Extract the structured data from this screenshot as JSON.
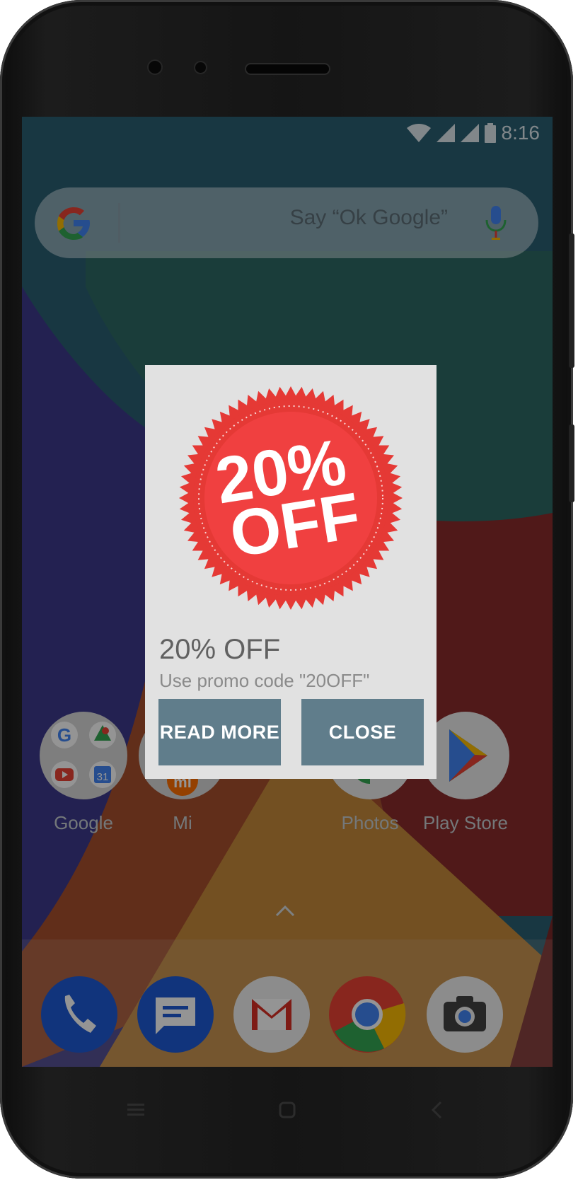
{
  "status_bar": {
    "time": "8:16",
    "icons": [
      "wifi-icon",
      "signal-icon",
      "signal-icon",
      "battery-icon"
    ]
  },
  "search": {
    "placeholder": "Say “Ok Google”",
    "logo": "google-g-icon",
    "voice_icon": "mic-icon"
  },
  "apps": [
    {
      "label": "Google",
      "icon": "google-folder-icon"
    },
    {
      "label": "Mi",
      "icon": "mi-folder-icon"
    },
    {
      "label": "Photos",
      "icon": "photos-icon"
    },
    {
      "label": "Play Store",
      "icon": "play-store-icon"
    }
  ],
  "dock": [
    {
      "icon": "phone-icon"
    },
    {
      "icon": "messages-icon"
    },
    {
      "icon": "gmail-icon"
    },
    {
      "icon": "chrome-icon"
    },
    {
      "icon": "camera-icon"
    }
  ],
  "dialog": {
    "badge_line1": "20%",
    "badge_line2": "OFF",
    "title": "20% OFF",
    "message": "Use promo code \"20OFF\"",
    "read_more_label": "READ MORE",
    "close_label": "CLOSE"
  },
  "nav": {
    "icons": [
      "menu-icon",
      "home-icon",
      "back-icon"
    ]
  },
  "colors": {
    "button": "#607d8b",
    "dialog_bg": "#e1e1e1",
    "badge_red": "#e53935"
  }
}
